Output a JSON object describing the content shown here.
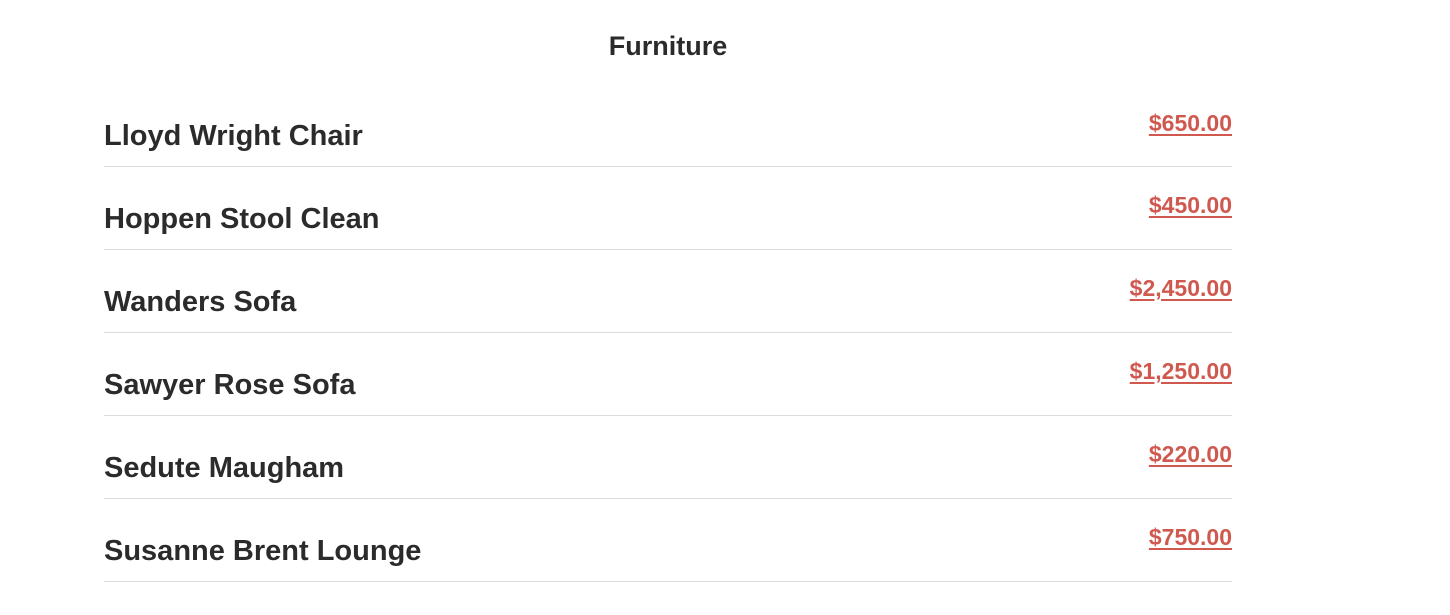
{
  "section": {
    "title": "Furniture"
  },
  "items": [
    {
      "name": "Lloyd Wright Chair",
      "price": "$650.00"
    },
    {
      "name": "Hoppen Stool Clean",
      "price": "$450.00"
    },
    {
      "name": "Wanders Sofa",
      "price": "$2,450.00"
    },
    {
      "name": "Sawyer Rose Sofa",
      "price": "$1,250.00"
    },
    {
      "name": "Sedute Maugham",
      "price": "$220.00"
    },
    {
      "name": "Susanne Brent Lounge",
      "price": "$750.00"
    }
  ],
  "colors": {
    "text": "#2b2b2b",
    "price_accent": "#d0594f",
    "divider": "#dcdcdc",
    "background": "#ffffff"
  }
}
